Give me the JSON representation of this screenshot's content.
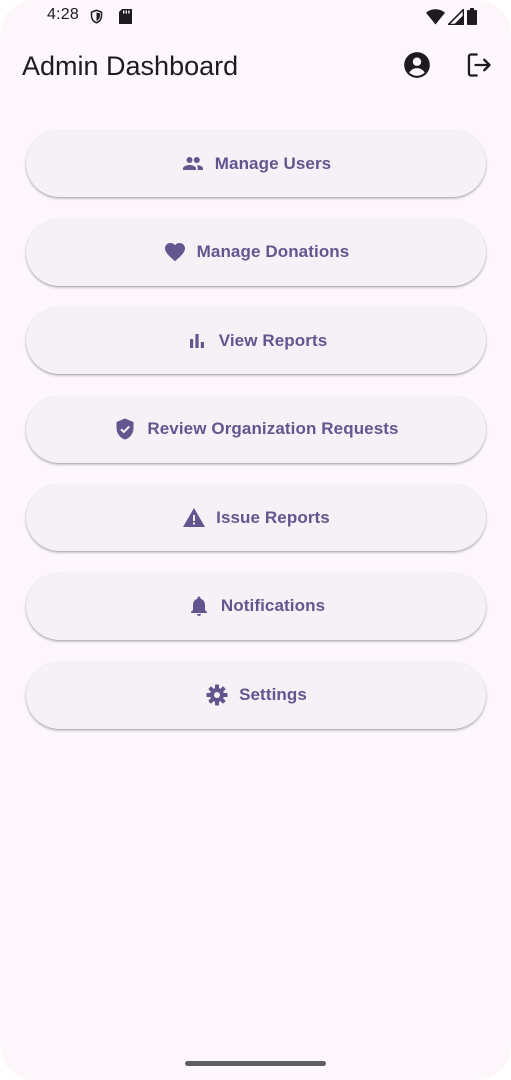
{
  "status_bar": {
    "time": "4:28",
    "icons": [
      "shield-icon",
      "sd-card-icon",
      "wifi-icon",
      "signal-icon",
      "battery-icon"
    ]
  },
  "app_bar": {
    "title": "Admin Dashboard",
    "actions": [
      "account-circle-icon",
      "logout-icon"
    ]
  },
  "menu": {
    "items": [
      {
        "label": "Manage Users",
        "icon": "people-icon"
      },
      {
        "label": "Manage Donations",
        "icon": "heart-icon"
      },
      {
        "label": "View Reports",
        "icon": "bar-chart-icon"
      },
      {
        "label": "Review Organization Requests",
        "icon": "verified-shield-icon"
      },
      {
        "label": "Issue Reports",
        "icon": "warning-icon"
      },
      {
        "label": "Notifications",
        "icon": "bell-icon"
      },
      {
        "label": "Settings",
        "icon": "gear-icon"
      }
    ]
  },
  "colors": {
    "background": "#fdf7fc",
    "button_surface": "#f6f0f7",
    "accent": "#65558f",
    "text_primary": "#1d1b20"
  }
}
